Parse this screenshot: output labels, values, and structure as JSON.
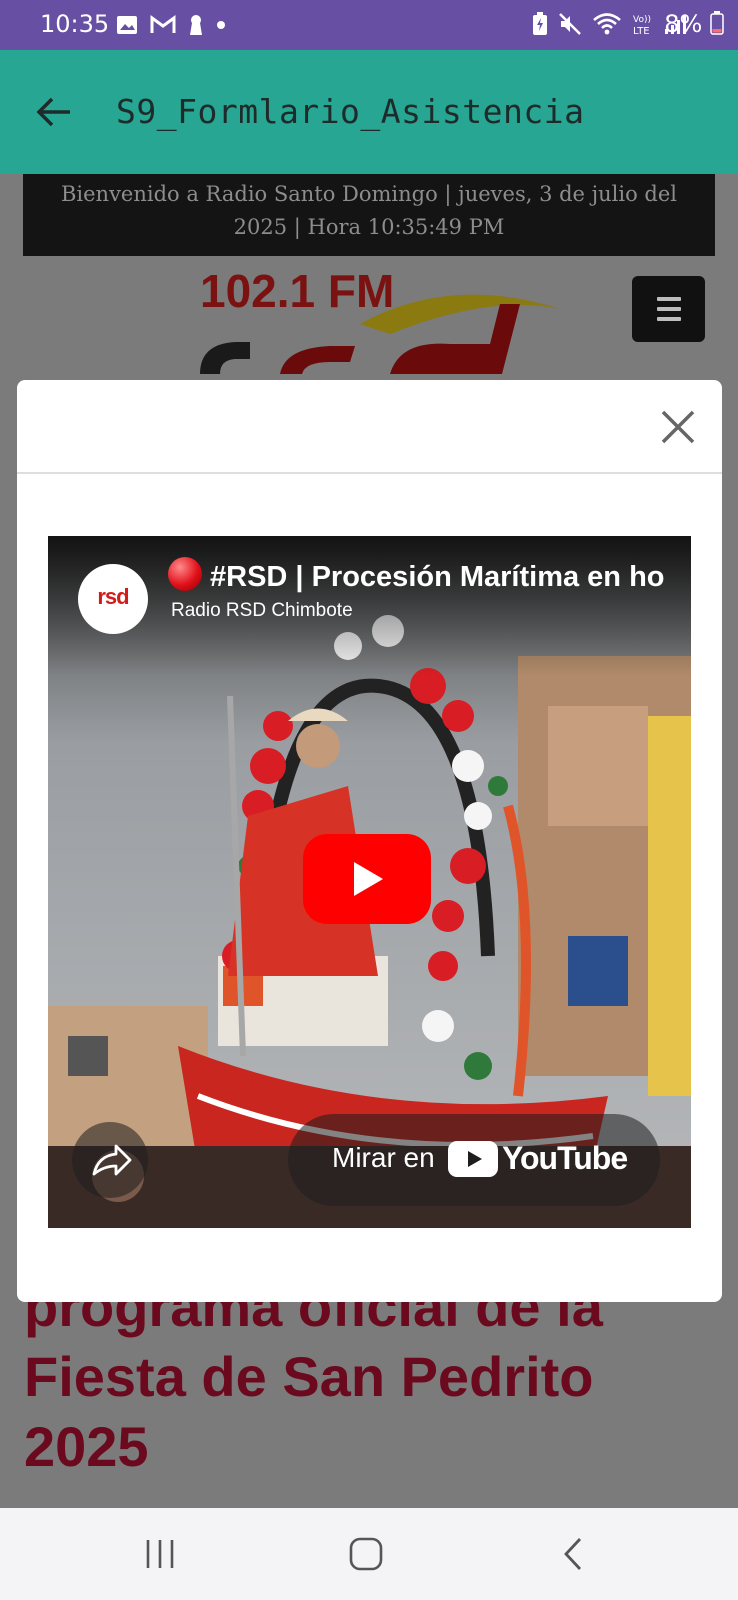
{
  "status": {
    "time": "10:35",
    "battery": "8%"
  },
  "appbar": {
    "title": "S9_Formlario_Asistencia"
  },
  "site": {
    "welcome_line1": "Bienvenido a Radio Santo Domingo   |   jueves, 3 de julio del",
    "welcome_line2": "2025   |   Hora 10:35:49 PM",
    "logo_freq": "102.1 FM",
    "logo_name": "rsd",
    "headline_lines": [
      "programa oficial de la",
      "Fiesta de San Pedrito",
      "2025"
    ]
  },
  "video": {
    "title": "#RSD | Procesión Marítima en ho",
    "channel": "Radio RSD Chimbote",
    "avatar_text": "rsd",
    "watch_label": "Mirar en",
    "youtube_word": "YouTube"
  },
  "colors": {
    "status_bar": "#6750a4",
    "app_bar": "#26a693",
    "headline": "#6b0a1e",
    "youtube_red": "#ff0000"
  },
  "icons": {
    "back": "arrow-left-icon",
    "close": "close-icon",
    "menu": "hamburger-icon",
    "play": "play-icon",
    "share": "share-icon"
  }
}
